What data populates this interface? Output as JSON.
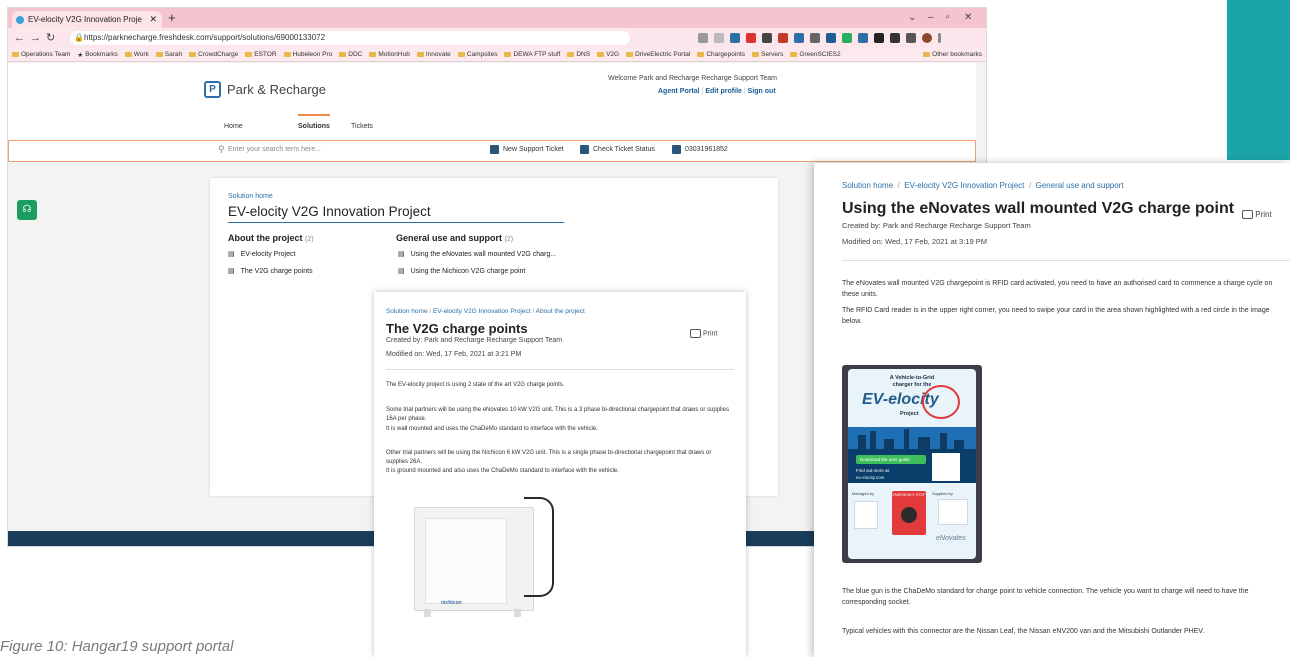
{
  "browser": {
    "tab_title": "EV-elocity V2G Innovation Proje",
    "tab_close": "✕",
    "new_tab": "+",
    "url": "https://parknecharge.freshdesk.com/support/solutions/69000133072",
    "bookmarks": [
      "Operations Team",
      "Bookmarks",
      "Work",
      "Sarah",
      "CrowdCharge",
      "ESTOR",
      "Hubeleon Pro",
      "DDC",
      "MotionHub",
      "Innovate",
      "Campsites",
      "DEWA FTP stuff",
      "DNS",
      "V2G",
      "DriveElectric Portal",
      "Chargepoints",
      "Servers",
      "GreenSCIES2"
    ],
    "other_bookmarks": "Other bookmarks"
  },
  "site": {
    "logo_letter": "P",
    "logo_text": "Park & Recharge",
    "welcome": "Welcome Park and Recharge Recharge Support Team",
    "links": [
      "Agent Portal",
      "Edit profile",
      "Sign out"
    ],
    "nav": [
      "Home",
      "Solutions",
      "Tickets"
    ],
    "search_placeholder": "Enter your search term here...",
    "actions": [
      "New Support Ticket",
      "Check Ticket Status",
      "03031961852"
    ]
  },
  "solutions": {
    "crumb": "Solution home",
    "title": "EV-elocity V2G Innovation Project",
    "about": {
      "heading": "About the project",
      "count": "(2)",
      "items": [
        "EV-elocity Project",
        "The V2G charge points"
      ]
    },
    "general": {
      "heading": "General use and support",
      "count": "(2)",
      "items": [
        "Using the eNovates wall mounted V2G charg...",
        "Using the Nichicon V2G charge point"
      ]
    }
  },
  "article1": {
    "crumbs": [
      "Solution home",
      "EV-elocity V2G Innovation Project",
      "About the project"
    ],
    "title": "The V2G charge points",
    "print": "Print",
    "created": "Created by: Park and Recharge Recharge Support Team",
    "modified": "Modified on: Wed, 17 Feb, 2021 at 3:21 PM",
    "p1": "The EV-elocity project is using 2 state of the art V2G charge points.",
    "p2a": "Some trial partners will be using the eNovates 10 kW V2G unit. This is a 3 phase bi-directional chargepoint that draws or supplies 16A per phase.",
    "p2b": "It is wall mounted and uses the ChaDeMo standard to interface with the vehicle.",
    "p3a": "Other trial partners will be using the Nichicon 6 kW V2G unit. This is a single phase bi-directional chargepoint that draws or supplies 26A.",
    "p3b": "It is ground mounted and also uses the ChaDeMo standard to interface with the vehicle.",
    "unit_brand": "nichicon"
  },
  "article2": {
    "crumbs": [
      "Solution home",
      "EV-elocity V2G Innovation Project",
      "General use and support"
    ],
    "title": "Using the eNovates wall mounted V2G charge point",
    "print": "Print",
    "created": "Created by: Park and Recharge Recharge Support Team",
    "modified": "Modified on: Wed, 17 Feb, 2021 at 3:19 PM",
    "p1": "The eNovates wall mounted V2G chargepoint is RFID card activated, you need to have an authorised card to commence a charge cycle on these units.",
    "p2": "The RFID Card reader is in the upper right corner, you need to swipe your card in the area shown highlighted with a red circle in the image below.",
    "p3": "The blue gun is the ChaDeMo standard for charge point to vehicle connection. The vehicle you want to charge will need to have the corresponding socket.",
    "p4": "Typical vehicles with this connector are the Nissan Leaf, the Nissan eNV200 van and the Mitsubishi Outlander PHEV.",
    "sticker": {
      "line1": "A Vehicle-to-Grid",
      "line2": "charger for the",
      "brand": "EV-elocity",
      "project": "Project",
      "button": "Download the user guide",
      "findout": "Find out more at:",
      "link": "ev-elocity.com",
      "emergency": "EMERGENCY STOP",
      "managed": "Managed by",
      "supplied": "Supplied by",
      "supplier": "eNovates"
    }
  },
  "caption": "Figure 10: Hangar19 support portal",
  "colors": {
    "accent_teal": "#1ba4aa",
    "link_blue": "#2b6fa6",
    "nav_orange": "#f08a4b",
    "chat_green": "#1a9d5f",
    "footer_navy": "#1b3d5c"
  }
}
